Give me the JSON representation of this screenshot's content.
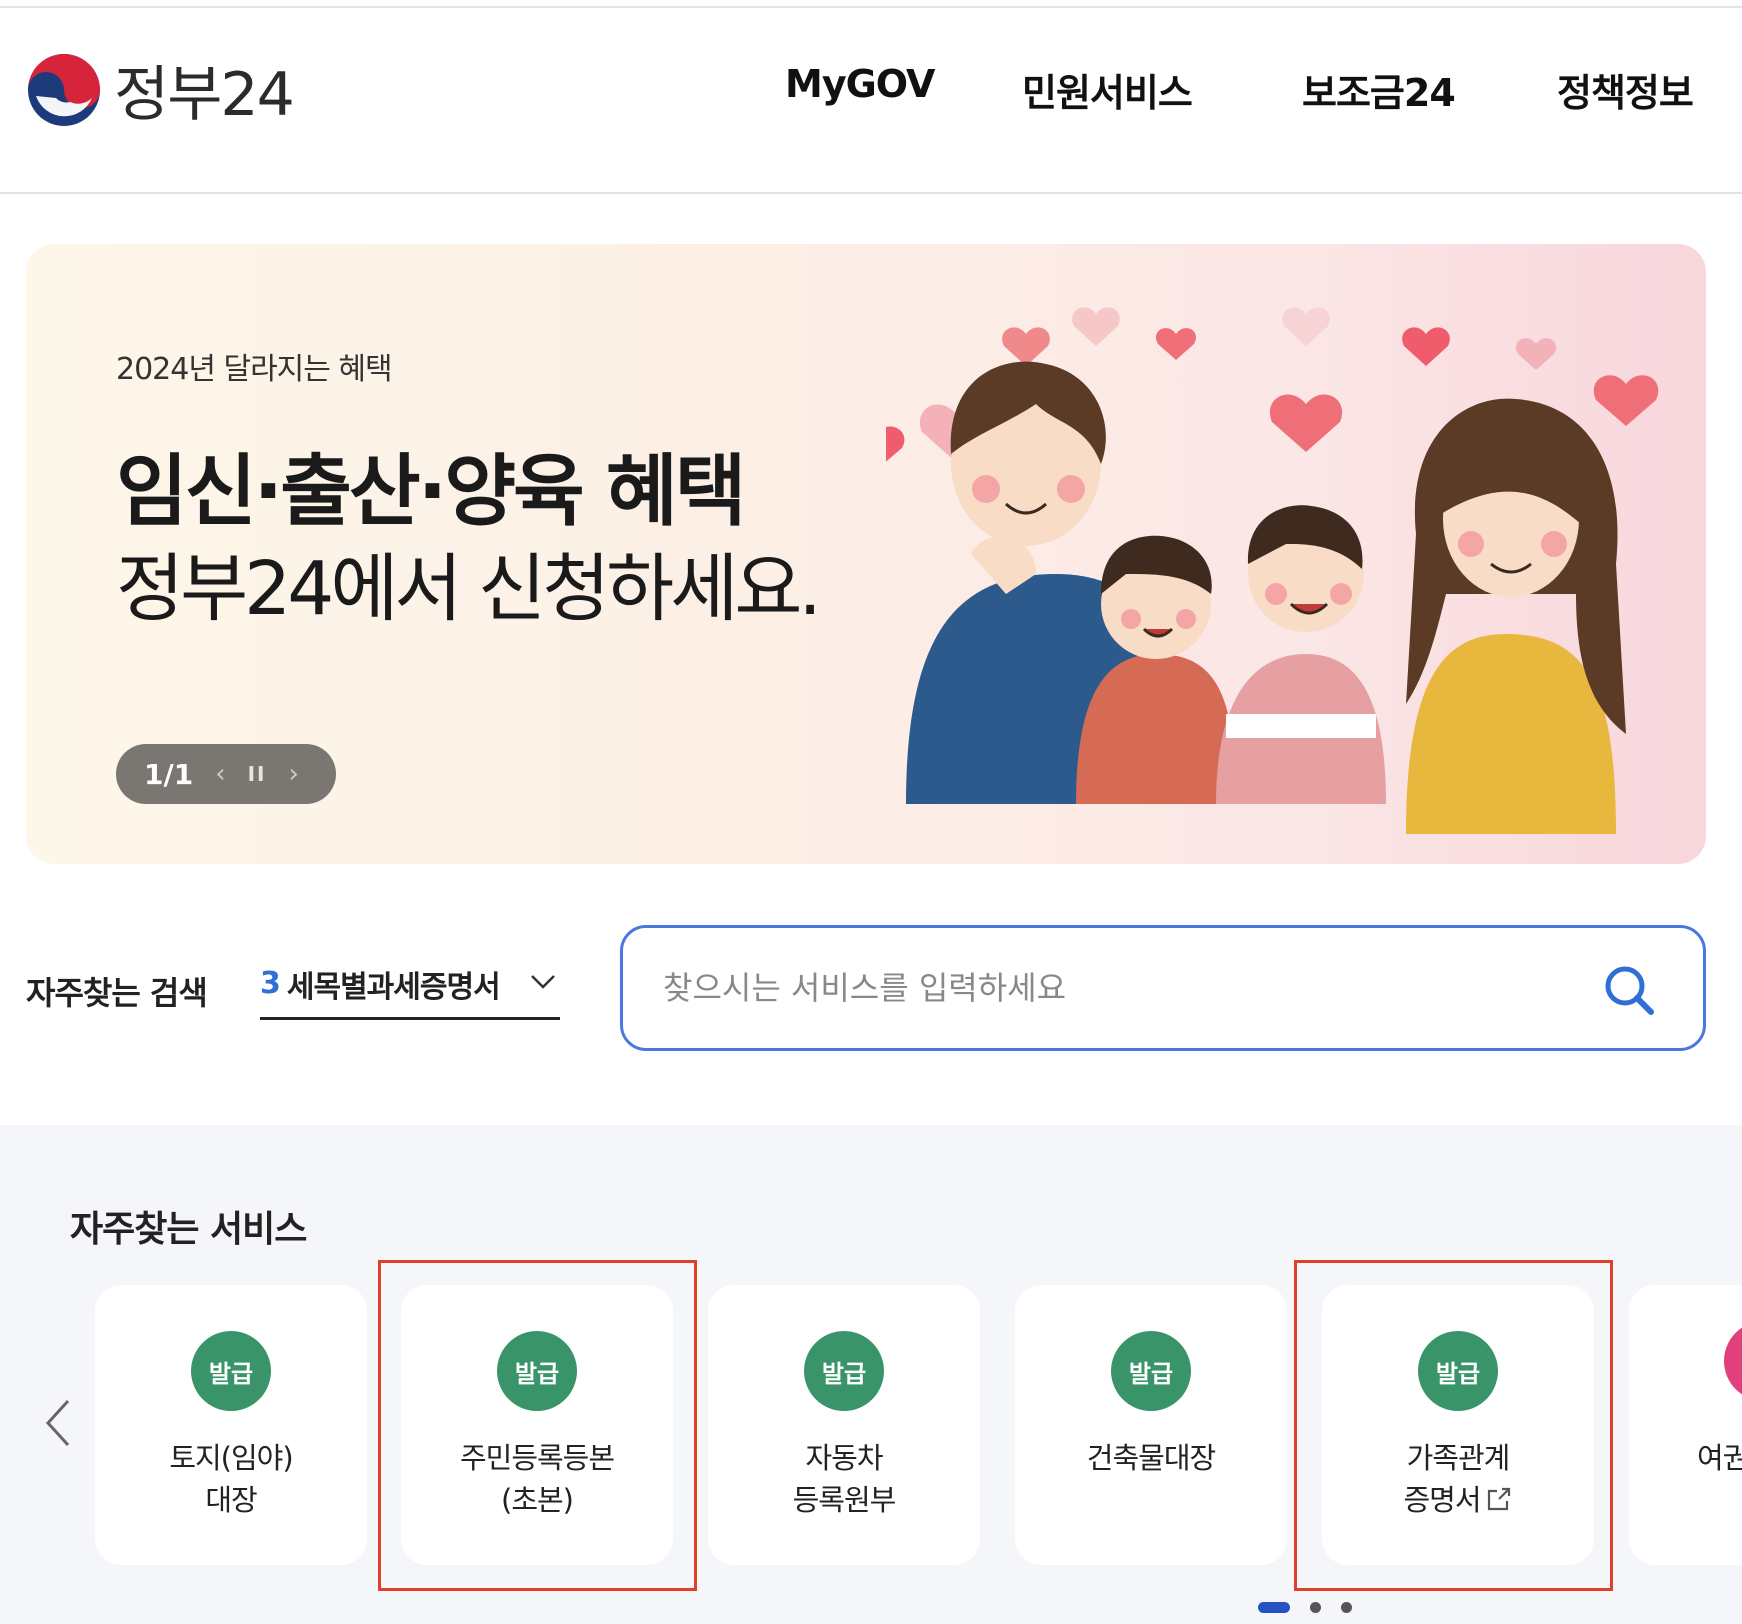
{
  "header": {
    "logo_text": "정부24",
    "nav": [
      {
        "label": "MyGOV"
      },
      {
        "label": "민원서비스"
      },
      {
        "label": "보조금24"
      },
      {
        "label": "정책정보"
      }
    ]
  },
  "banner": {
    "subtitle": "2024년 달라지는 혜택",
    "title_line1": "임신·출산·양육 혜택",
    "title_line2": "정부24에서 신청하세요.",
    "slide_counter": "1/1",
    "prev_glyph": "‹",
    "pause_glyph": "II",
    "next_glyph": "›"
  },
  "search": {
    "frequent_label": "자주찾는 검색",
    "frequent_rank": "3",
    "frequent_term": "세목별과세증명서",
    "placeholder": "찾으시는 서비스를 입력하세요"
  },
  "services": {
    "title": "자주찾는 서비스",
    "cards": [
      {
        "badge": "발급",
        "line1": "토지(임야)",
        "line2": "대장"
      },
      {
        "badge": "발급",
        "line1": "주민등록등본",
        "line2": "(초본)"
      },
      {
        "badge": "발급",
        "line1": "자동차",
        "line2": "등록원부"
      },
      {
        "badge": "발급",
        "line1": "건축물대장",
        "line2": ""
      },
      {
        "badge": "발급",
        "line1": "가족관계",
        "line2": "증명서"
      },
      {
        "badge": "",
        "line1": "여권",
        "line2": ""
      }
    ],
    "page_dots": 3,
    "active_dot": 1
  },
  "colors": {
    "accent_blue": "#4a78e0",
    "badge_green": "#3a946a",
    "highlight_red": "#e0402a",
    "dot_active": "#2552c2"
  }
}
